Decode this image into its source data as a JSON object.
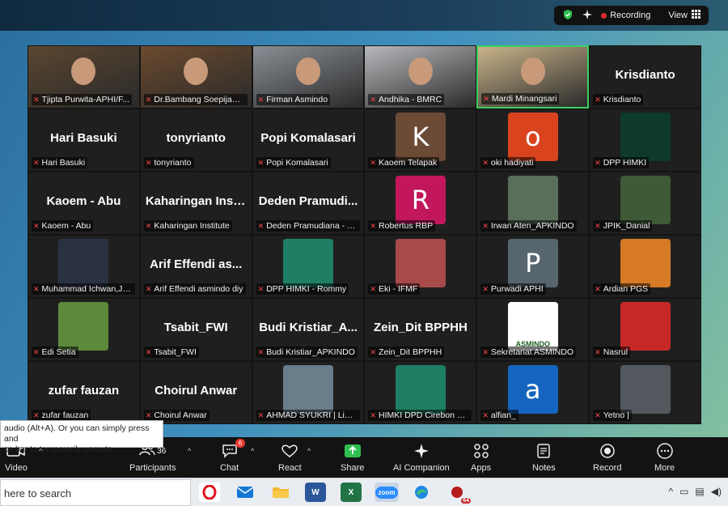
{
  "top_status": {
    "recording_label": "Recording",
    "view_label": "View"
  },
  "participants": [
    {
      "name": "Tjipta Purwita-APHI/F...",
      "type": "video",
      "bg": "#5a4630"
    },
    {
      "name": "Dr.Bambang Soepijant...",
      "type": "video",
      "bg": "#6b4a2e"
    },
    {
      "name": "Firman Asmindo",
      "type": "video",
      "bg": "#8a8f95"
    },
    {
      "name": "Andhika - BMRC",
      "type": "video",
      "bg": "#b7b9bc"
    },
    {
      "name": "Mardi Minangsari",
      "type": "video",
      "bg": "#c9b48a",
      "active": true
    },
    {
      "name": "Krisdianto",
      "big": "Krisdianto",
      "type": "text"
    },
    {
      "name": "Hari Basuki",
      "big": "Hari Basuki",
      "type": "text"
    },
    {
      "name": "tonyrianto",
      "big": "tonyrianto",
      "type": "text"
    },
    {
      "name": "Popi Komalasari",
      "big": "Popi Komalasari",
      "type": "text"
    },
    {
      "name": "Kaoem Telapak",
      "type": "letter",
      "letter": "K",
      "color": "#6b4a36"
    },
    {
      "name": "oki hadiyati",
      "type": "letter",
      "letter": "o",
      "color": "#d9441f"
    },
    {
      "name": "DPP HIMKI",
      "type": "photo",
      "bg": "#0e3a2e"
    },
    {
      "name": "Kaoem - Abu",
      "big": "Kaoem - Abu",
      "type": "text"
    },
    {
      "name": "Kaharingan Institute",
      "big": "Kaharingan Inst...",
      "type": "text"
    },
    {
      "name": "Deden Pramudiana - Y...",
      "big": "Deden Pramudi...",
      "type": "text"
    },
    {
      "name": "Robertus RBP",
      "type": "letter",
      "letter": "R",
      "color": "#c2185b"
    },
    {
      "name": "Irwan Aten_APKINDO",
      "type": "photo",
      "bg": "#5a6e5a"
    },
    {
      "name": "JPIK_Danial",
      "type": "photo",
      "bg": "#3e5a36"
    },
    {
      "name": "Muhammad Ichwan,JP...",
      "type": "photo",
      "bg": "#2a3242"
    },
    {
      "name": "Arif Effendi asmindo diy",
      "big": "Arif Effendi as...",
      "type": "text"
    },
    {
      "name": "DPP HIMKI - Rommy",
      "type": "photo",
      "bg": "#1e7f64"
    },
    {
      "name": "Eki - IFMF",
      "type": "photo",
      "bg": "#a84a4a"
    },
    {
      "name": "Purwadi APHI",
      "type": "letter",
      "letter": "P",
      "color": "#56656e"
    },
    {
      "name": "Ardian PGS",
      "type": "photo",
      "bg": "#d77a26"
    },
    {
      "name": "Edi Setia",
      "type": "photo",
      "bg": "#5c8a3a"
    },
    {
      "name": "Tsabit_FWI",
      "big": "Tsabit_FWI",
      "type": "text"
    },
    {
      "name": "Budi Kristiar_APKINDO",
      "big": "Budi Kristiar_A...",
      "type": "text"
    },
    {
      "name": "Zein_Dit BPPHH",
      "big": "Zein_Dit BPPHH",
      "type": "text"
    },
    {
      "name": "Sekretariat ASMINDO",
      "type": "photo",
      "bg": "#ffffff",
      "caption": "ASMINDO"
    },
    {
      "name": "Nasrul",
      "type": "photo",
      "bg": "#c62828"
    },
    {
      "name": "zufar fauzan",
      "big": "zufar fauzan",
      "type": "text"
    },
    {
      "name": "Choirul Anwar",
      "big": "Choirul Anwar",
      "type": "text"
    },
    {
      "name": "AHMAD SYUKRI | Link-...",
      "type": "photo",
      "bg": "#6a7d8a"
    },
    {
      "name": "HIMKI DPD Cirebon Ra...",
      "type": "photo",
      "bg": "#1e7f64"
    },
    {
      "name": "alfian_",
      "type": "letter",
      "letter": "a",
      "color": "#1565c0"
    },
    {
      "name": "Yetno |",
      "type": "photo",
      "bg": "#52585e"
    }
  ],
  "tooltip": {
    "line1": "audio (Alt+A). Or you can simply press and",
    "line2": "ce bar to temporarily unmute."
  },
  "toolbar": {
    "video": "Video",
    "participants": "Participants",
    "participants_count": "36",
    "chat": "Chat",
    "chat_badge": "6",
    "react": "React",
    "share": "Share",
    "ai": "AI Companion",
    "apps": "Apps",
    "notes": "Notes",
    "record": "Record",
    "more": "More"
  },
  "taskbar": {
    "search_placeholder": "here to search",
    "zoom_label": "zoom",
    "badge_64": "64"
  },
  "colors": {
    "accent_green": "#3ccf5e",
    "mute_red": "#ff4848",
    "share_green": "#2fbf4f"
  }
}
